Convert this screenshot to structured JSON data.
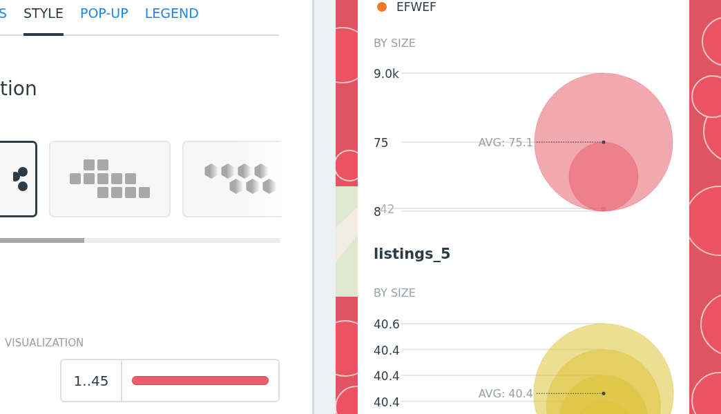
{
  "tabs": [
    {
      "label": "S",
      "selected": false
    },
    {
      "label": "STYLE",
      "selected": true
    },
    {
      "label": "POP-UP",
      "selected": false
    },
    {
      "label": "LEGEND",
      "selected": false
    }
  ],
  "section_title": "tion",
  "visualization_options": [
    {
      "kind": "dots",
      "selected": true
    },
    {
      "kind": "squares",
      "selected": false
    },
    {
      "kind": "hexagons",
      "selected": false
    }
  ],
  "visualization_label": "VISUALIZATION",
  "size_ramp": {
    "range": "1..45"
  },
  "legend": {
    "layers": [
      {
        "categories": [
          {
            "label": "EFWEF",
            "color": "#f07a2a"
          }
        ],
        "size_title": "BY SIZE",
        "color": "#e8606e",
        "size_labels": [
          {
            "text": "9.0k",
            "faded": false
          },
          {
            "text": "75",
            "faded": false
          },
          {
            "text": "42",
            "faded": true
          },
          {
            "text": "8",
            "faded": false
          }
        ],
        "avg": "AVG: 75.1"
      },
      {
        "title": "listings_5",
        "size_title": "BY SIZE",
        "color": "#dcc33a",
        "size_labels": [
          {
            "text": "40.6",
            "faded": false
          },
          {
            "text": "40.4",
            "faded": false
          },
          {
            "text": "40.4",
            "faded": false
          },
          {
            "text": "40.4",
            "faded": false
          }
        ],
        "avg": "AVG: 40.4"
      }
    ]
  }
}
